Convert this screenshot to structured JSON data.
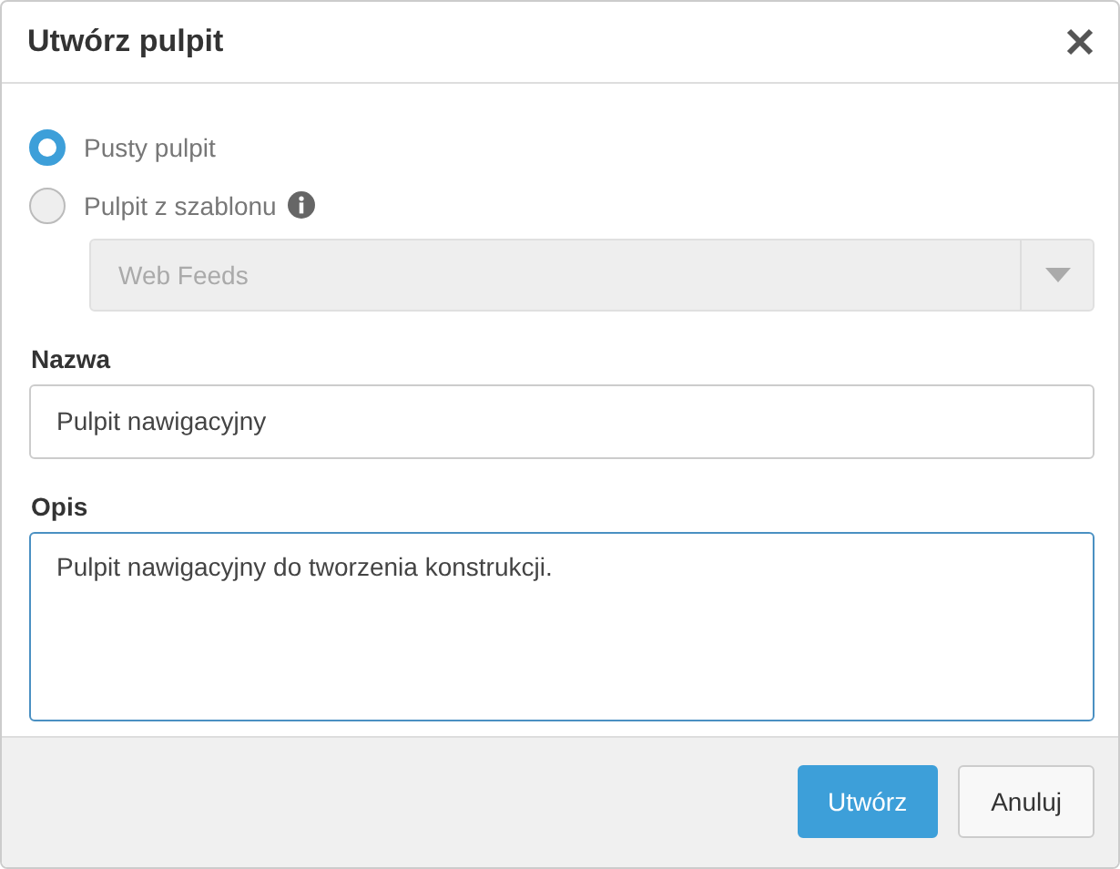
{
  "dialog": {
    "title": "Utwórz pulpit"
  },
  "options": [
    {
      "label": "Pusty pulpit",
      "selected": true,
      "info": false
    },
    {
      "label": "Pulpit z szablonu",
      "selected": false,
      "info": true
    }
  ],
  "template_select": {
    "value": "Web Feeds",
    "disabled": true
  },
  "fields": [
    {
      "kind": "input",
      "label": "Nazwa",
      "value": "Pulpit nawigacyjny",
      "focused": false
    },
    {
      "kind": "textarea",
      "label": "Opis",
      "value": "Pulpit nawigacyjny do tworzenia konstrukcji.",
      "focused": true
    }
  ],
  "buttons": [
    {
      "label": "Utwórz",
      "kind": "primary"
    },
    {
      "label": "Anuluj",
      "kind": "default"
    }
  ]
}
